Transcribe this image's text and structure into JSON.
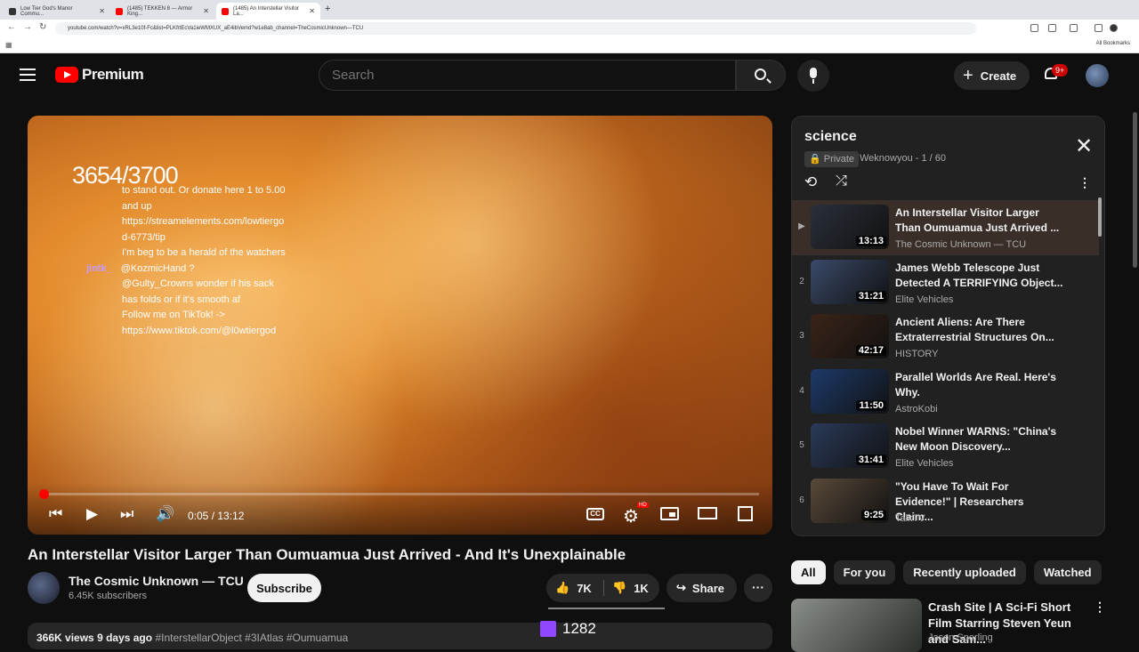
{
  "browser": {
    "tabs": [
      {
        "title": "Low Tier God's Manor Commu..."
      },
      {
        "title": "(1485) TEKKEN 8 — Armor King..."
      },
      {
        "title": "(1485) An Interstellar Visitor La..."
      }
    ],
    "url": "youtube.com/watch?v=xRL3e10f-Fc&list=PLKfrtEcVa1ieWMXUX_aE4ibVemd?w1e8ab_channel=TheCosmicUnknown—TCU",
    "bookmarks_label": "All Bookmarks"
  },
  "header": {
    "logo_text": "Premium",
    "search_placeholder": "Search",
    "create_label": "Create",
    "notif_count": "9+"
  },
  "overlay": {
    "counter": "3654/3700",
    "chat": [
      {
        "name": "",
        "text": "to stand out. Or donate here 1 to 5.00"
      },
      {
        "name": "",
        "text": "and up"
      },
      {
        "name": "",
        "text": "https://streamelements.com/lowtiergo"
      },
      {
        "name": "",
        "text": "d-6773/tip"
      },
      {
        "name": "",
        "text": "I'm beg to be a herald of the watchers"
      },
      {
        "name": "jintk_",
        "text": "@KozmicHand ?"
      },
      {
        "name": "",
        "text": "@Gulty_Crowns wonder if his sack"
      },
      {
        "name": "",
        "text": "has folds or if it's smooth af"
      },
      {
        "name": "",
        "text": "Follow me on TikTok! ->"
      },
      {
        "name": "",
        "text": "https://www.tiktok.com/@l0wtiergod"
      }
    ]
  },
  "player": {
    "time": "0:05 / 13:12",
    "progress": 0.006,
    "cc_label": "CC",
    "hd_label": "HD"
  },
  "video": {
    "title": "An Interstellar Visitor Larger Than Oumuamua Just Arrived - And It's Unexplainable",
    "channel": "The Cosmic Unknown — TCU",
    "subscribers": "6.45K subscribers",
    "subscribe_label": "Subscribe",
    "likes": "7K",
    "dislikes": "1K",
    "share_label": "Share",
    "views": "366K views",
    "age": "9 days ago",
    "tags": "#InterstellarObject #3IAtlas #Oumuamua",
    "twitch_count": "1282"
  },
  "playlist": {
    "title": "science",
    "privacy": "Private",
    "owner": "Weknowyou - 1 / 60",
    "items": [
      {
        "idx": "▶",
        "title": "An Interstellar Visitor Larger Than Oumuamua Just Arrived ...",
        "channel": "The Cosmic Unknown — TCU",
        "duration": "13:13",
        "color": "#2a2f3a"
      },
      {
        "idx": "2",
        "title": "James Webb Telescope Just Detected A TERRIFYING Object...",
        "channel": "Elite Vehicles",
        "duration": "31:21",
        "color": "#3a4a6a"
      },
      {
        "idx": "3",
        "title": "Ancient Aliens: Are There Extraterrestrial Structures On...",
        "channel": "HISTORY",
        "duration": "42:17",
        "color": "#3a2418"
      },
      {
        "idx": "4",
        "title": "Parallel Worlds Are Real. Here's Why.",
        "channel": "AstroKobi",
        "duration": "11:50",
        "color": "#1d3a6a"
      },
      {
        "idx": "5",
        "title": "Nobel Winner WARNS: \"China's New Moon Discovery...",
        "channel": "Elite Vehicles",
        "duration": "31:41",
        "color": "#2a3a5a"
      },
      {
        "idx": "6",
        "title": "\"You Have To Wait For Evidence!\" | Researchers Claim...",
        "channel": "TalkTV",
        "duration": "9:25",
        "color": "#5a4a3a"
      }
    ]
  },
  "chips": [
    "All",
    "For you",
    "Recently uploaded",
    "Watched"
  ],
  "recommended": {
    "title": "Crash Site | A Sci-Fi Short Film Starring Steven Yeun and Sam...",
    "channel": "Jason Sperling"
  }
}
